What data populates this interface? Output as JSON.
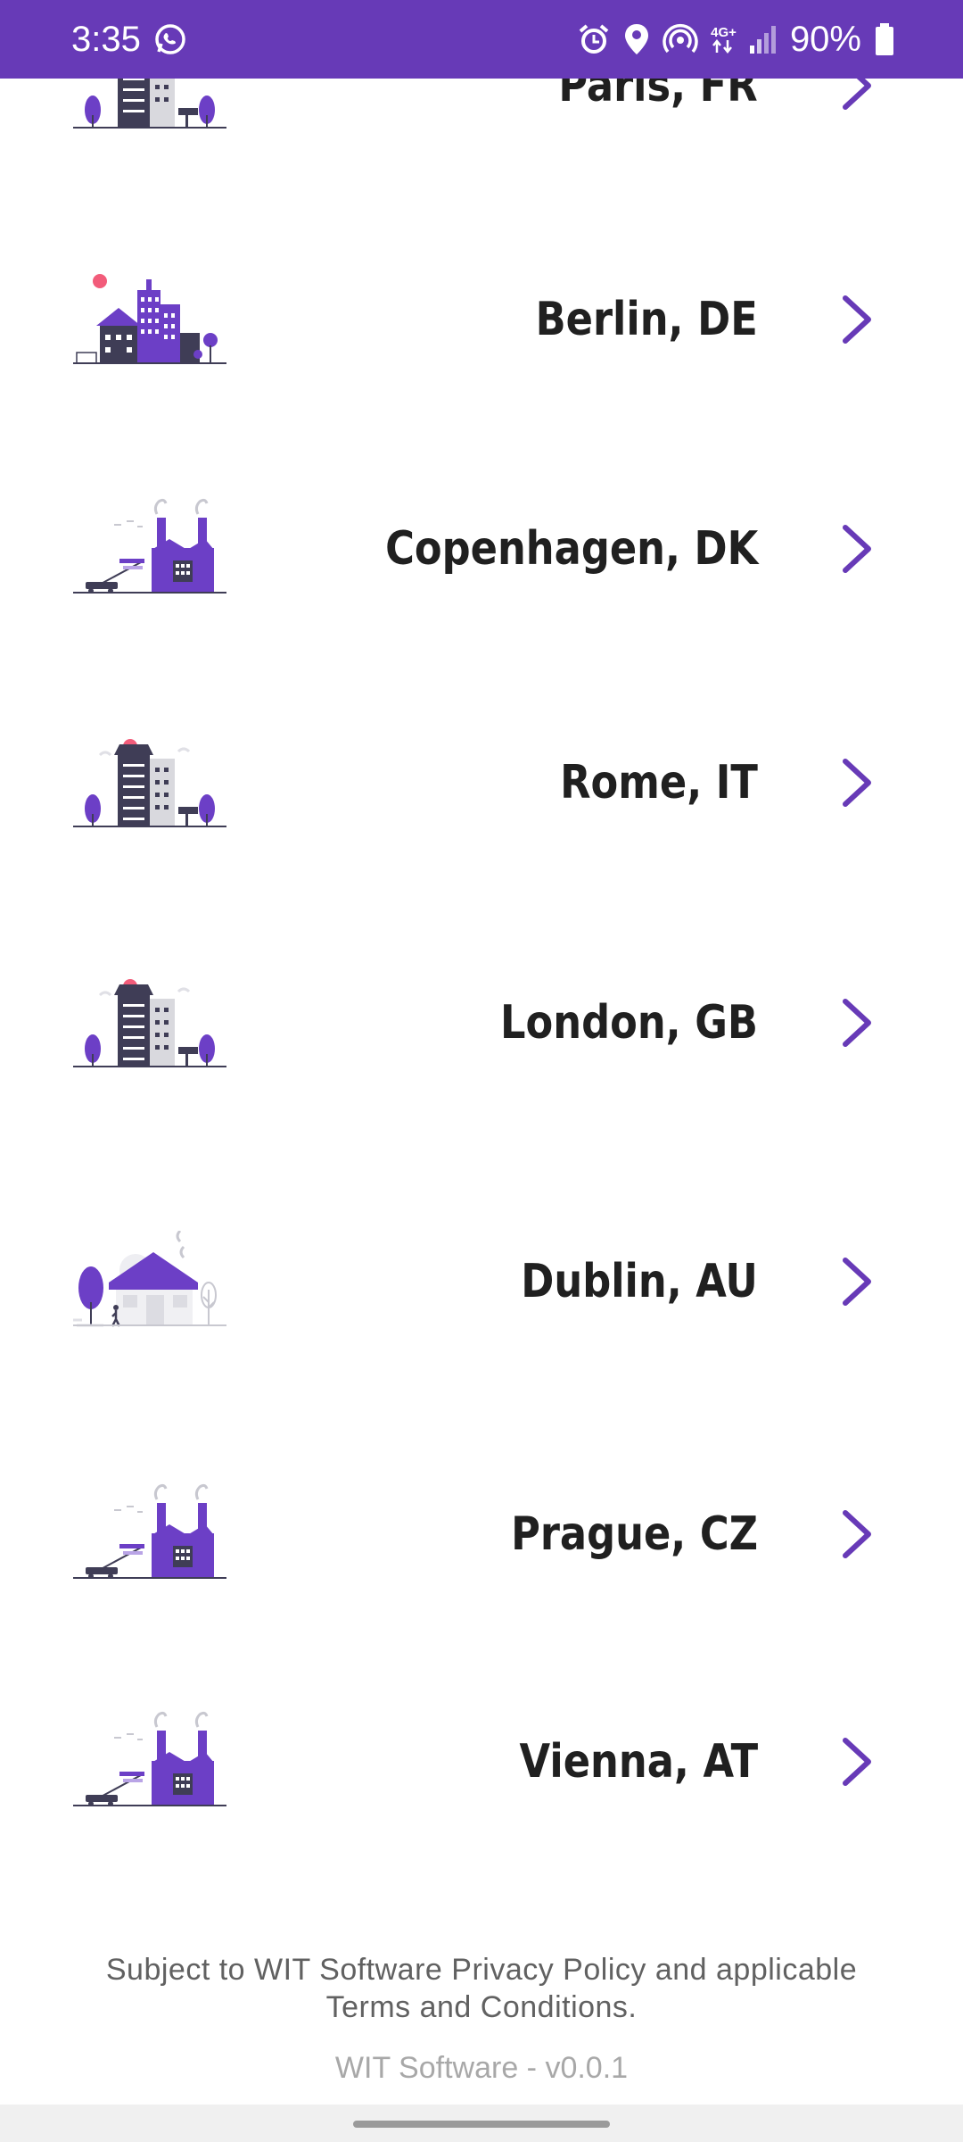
{
  "status_bar": {
    "time": "3:35",
    "network_type": "4G+",
    "battery": "90%",
    "icons": [
      "whatsapp-icon",
      "alarm-icon",
      "location-icon",
      "hotspot-icon",
      "network-4g-icon",
      "signal-icon",
      "battery-icon"
    ]
  },
  "colors": {
    "primary": "#673ab7",
    "accent_purple": "#6c3fc6",
    "text_dark": "#202020",
    "pink": "#f25c7a"
  },
  "cities": [
    {
      "name": "Paris, FR",
      "illustration": "city-building-illustration"
    },
    {
      "name": "Berlin, DE",
      "illustration": "city-skyline-illustration"
    },
    {
      "name": "Copenhagen, DK",
      "illustration": "factory-illustration"
    },
    {
      "name": "Rome, IT",
      "illustration": "city-building-illustration"
    },
    {
      "name": "London, GB",
      "illustration": "city-building-illustration"
    },
    {
      "name": "Dublin, AU",
      "illustration": "house-illustration"
    },
    {
      "name": "Prague, CZ",
      "illustration": "factory-illustration"
    },
    {
      "name": "Vienna, AT",
      "illustration": "factory-illustration"
    }
  ],
  "footer": {
    "legal_line1": "Subject to WIT Software Privacy Policy and applicable",
    "legal_line2": "Terms and Conditions.",
    "version": "WIT Software - v0.0.1"
  }
}
